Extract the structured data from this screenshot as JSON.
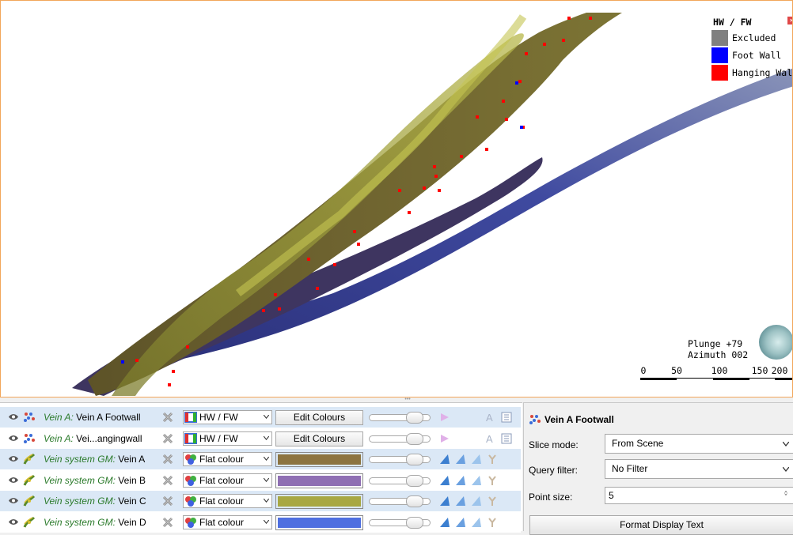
{
  "legend": {
    "title": "HW / FW",
    "items": [
      {
        "label": "Excluded",
        "color": "#808080"
      },
      {
        "label": "Foot Wall",
        "color": "#0000ff"
      },
      {
        "label": "Hanging Wall",
        "color": "#ff0000"
      }
    ]
  },
  "orientation": {
    "plunge": "Plunge +79",
    "azimuth": "Azimuth 002"
  },
  "scale_bar": {
    "ticks": [
      "0",
      "50",
      "100",
      "150",
      "200"
    ]
  },
  "shape_list": {
    "rows": [
      {
        "source": "Vein A:",
        "name": " Vein A Footwall",
        "mode": "HW / FW",
        "mode_icon": "colour-map-icon",
        "button": "Edit Colours",
        "colour": null,
        "selected": true
      },
      {
        "source": "Vein A:",
        "name": " Vei...angingwall",
        "mode": "HW / FW",
        "mode_icon": "colour-map-icon",
        "button": "Edit Colours",
        "colour": null,
        "selected": false
      },
      {
        "source": "Vein system GM:",
        "name": " Vein A",
        "mode": "Flat colour",
        "mode_icon": "flat-colour-icon",
        "button": null,
        "colour": "#8c7440",
        "selected": true
      },
      {
        "source": "Vein system GM:",
        "name": " Vein B",
        "mode": "Flat colour",
        "mode_icon": "flat-colour-icon",
        "button": null,
        "colour": "#8f6fb3",
        "selected": false
      },
      {
        "source": "Vein system GM:",
        "name": " Vein C",
        "mode": "Flat colour",
        "mode_icon": "flat-colour-icon",
        "button": null,
        "colour": "#a8a843",
        "selected": true
      },
      {
        "source": "Vein system GM:",
        "name": " Vein D",
        "mode": "Flat colour",
        "mode_icon": "flat-colour-icon",
        "button": null,
        "colour": "#4f6fe0",
        "selected": false
      }
    ]
  },
  "properties": {
    "title": "Vein A Footwall",
    "slice_mode_label": "Slice mode:",
    "slice_mode_value": "From Scene",
    "query_filter_label": "Query filter:",
    "query_filter_value": "No Filter",
    "point_size_label": "Point size:",
    "point_size_value": "5",
    "format_button": "Format Display Text"
  }
}
